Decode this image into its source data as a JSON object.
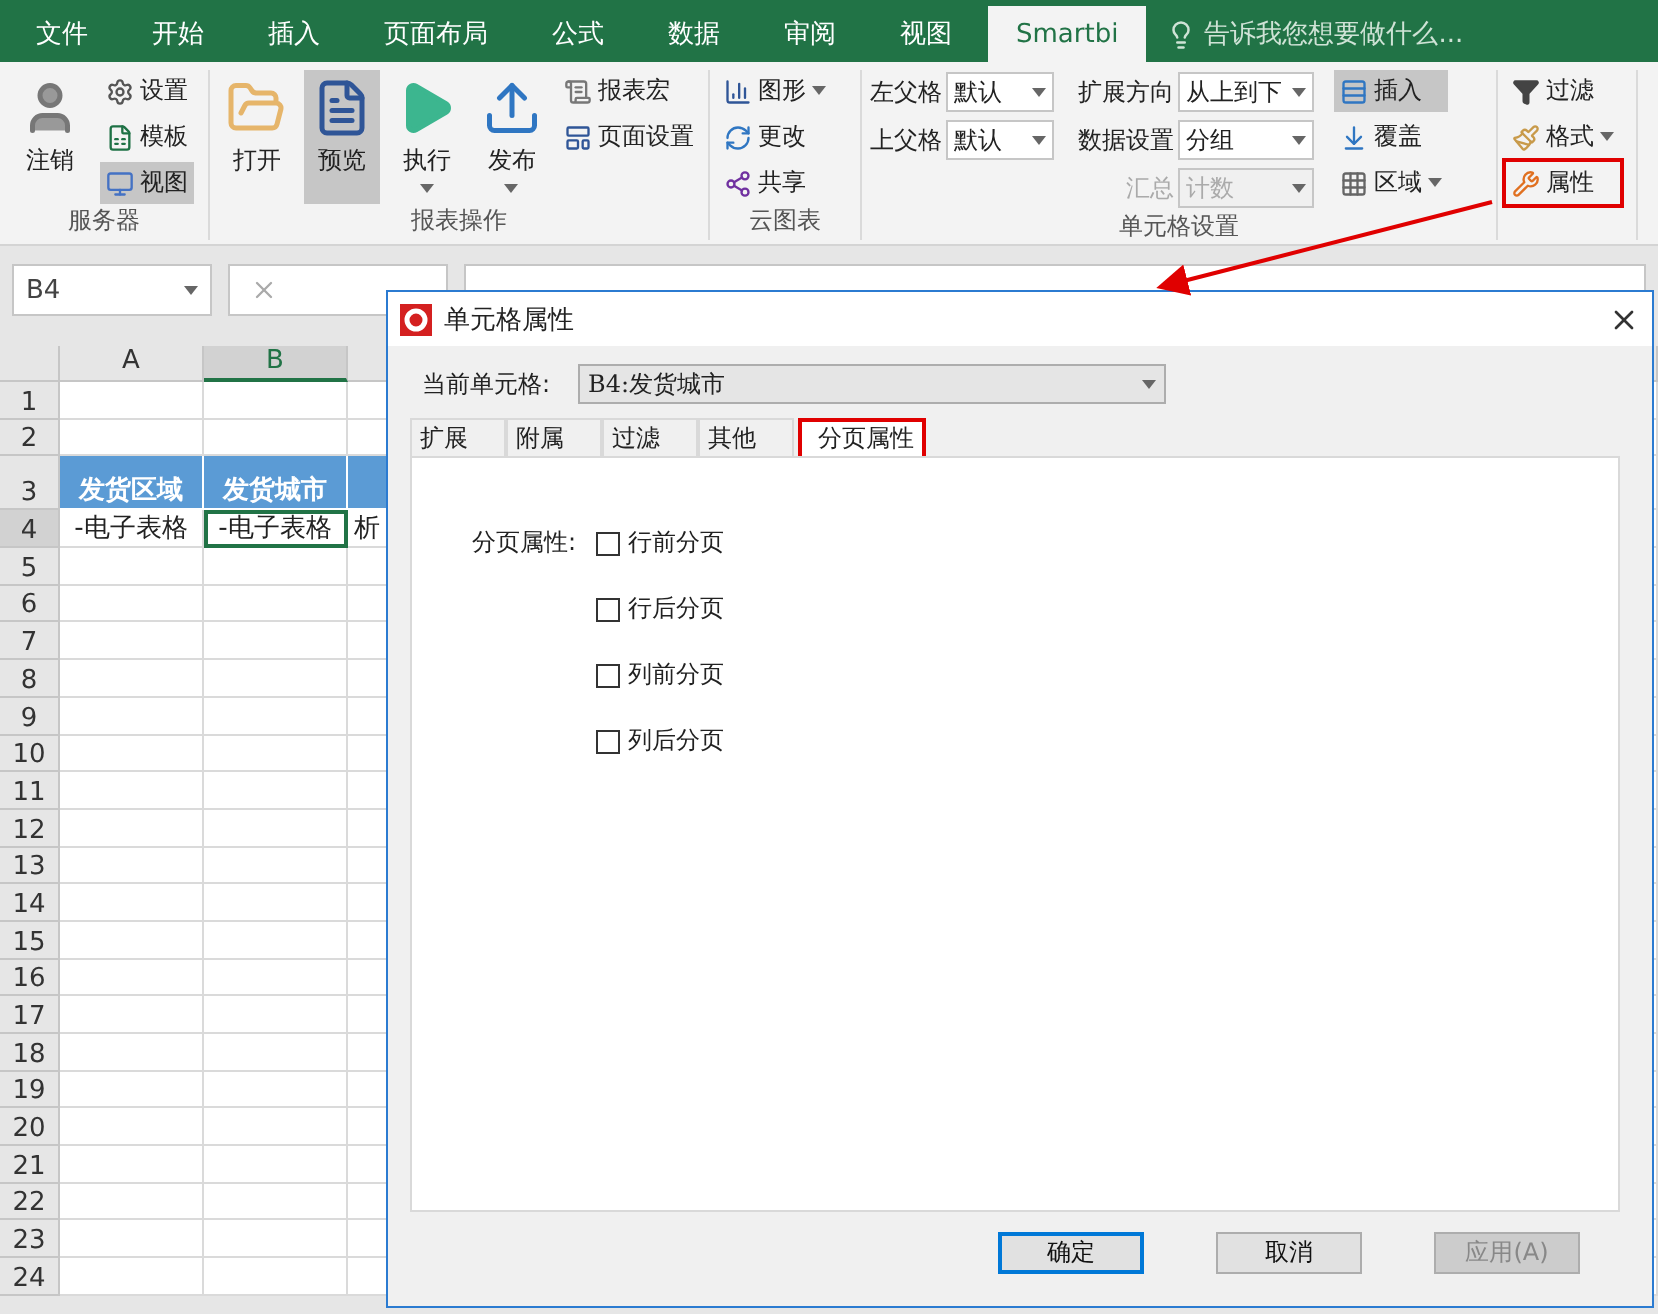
{
  "menu_tabs": [
    {
      "label": "文件",
      "selected": false
    },
    {
      "label": "开始",
      "selected": false
    },
    {
      "label": "插入",
      "selected": false
    },
    {
      "label": "页面布局",
      "selected": false
    },
    {
      "label": "公式",
      "selected": false
    },
    {
      "label": "数据",
      "selected": false
    },
    {
      "label": "审阅",
      "selected": false
    },
    {
      "label": "视图",
      "selected": false
    },
    {
      "label": "Smartbi",
      "selected": true
    }
  ],
  "tell_me": {
    "placeholder": "告诉我您想要做什么..."
  },
  "ribbon": {
    "server": {
      "title": "服务器",
      "large": {
        "label": "注销"
      },
      "small": [
        {
          "label": "设置",
          "selected": false
        },
        {
          "label": "模板",
          "selected": false
        },
        {
          "label": "视图",
          "selected": true
        }
      ]
    },
    "report": {
      "title": "报表操作",
      "large": [
        {
          "label": "打开",
          "selected": false,
          "dropdown": false
        },
        {
          "label": "预览",
          "selected": true,
          "dropdown": false
        },
        {
          "label": "执行",
          "selected": false,
          "dropdown": true
        },
        {
          "label": "发布",
          "selected": false,
          "dropdown": true
        }
      ],
      "small": [
        {
          "label": "报表宏"
        },
        {
          "label": "页面设置"
        }
      ]
    },
    "cloud": {
      "title": "云图表",
      "items": [
        {
          "label": "图形",
          "dropdown": true
        },
        {
          "label": "更改",
          "dropdown": false
        },
        {
          "label": "共享",
          "dropdown": false
        }
      ]
    },
    "cell": {
      "title": "单元格设置",
      "left_fields": [
        {
          "label": "左父格",
          "value": "默认",
          "disabled": false
        },
        {
          "label": "上父格",
          "value": "默认",
          "disabled": false
        }
      ],
      "right_fields": [
        {
          "label": "扩展方向",
          "value": "从上到下",
          "disabled": false
        },
        {
          "label": "数据设置",
          "value": "分组",
          "disabled": false
        },
        {
          "label": "汇总",
          "value": "计数",
          "disabled": true
        }
      ],
      "modes": [
        {
          "label": "插入",
          "selected": true,
          "dropdown": false
        },
        {
          "label": "覆盖",
          "selected": false,
          "dropdown": false
        },
        {
          "label": "区域",
          "selected": false,
          "dropdown": true
        }
      ]
    },
    "tools": [
      {
        "label": "过滤",
        "dropdown": false,
        "highlighted": false
      },
      {
        "label": "格式",
        "dropdown": true,
        "highlighted": false
      },
      {
        "label": "属性",
        "dropdown": false,
        "highlighted": true
      }
    ]
  },
  "name_box": {
    "value": "B4"
  },
  "sheet": {
    "columns": [
      {
        "label": "A",
        "selected": false
      },
      {
        "label": "B",
        "selected": true
      }
    ],
    "rows": [
      {
        "label": "1",
        "kind": "plain",
        "selected": false
      },
      {
        "label": "2",
        "kind": "plain",
        "selected": false
      },
      {
        "label": "3",
        "kind": "header",
        "selected": false,
        "cells": [
          {
            "text": "发货区域",
            "selected": false
          },
          {
            "text": "发货城市",
            "selected": false
          }
        ]
      },
      {
        "label": "4",
        "kind": "plain",
        "selected": true,
        "cells": [
          {
            "text": "-电子表格",
            "selected": false
          },
          {
            "text": "-电子表格",
            "selected": true
          },
          {
            "text": "析",
            "selected": false
          }
        ]
      },
      {
        "label": "5",
        "kind": "plain",
        "selected": false
      },
      {
        "label": "6",
        "kind": "plain",
        "selected": false
      },
      {
        "label": "7",
        "kind": "plain",
        "selected": false
      },
      {
        "label": "8",
        "kind": "plain",
        "selected": false
      },
      {
        "label": "9",
        "kind": "plain",
        "selected": false
      },
      {
        "label": "10",
        "kind": "plain",
        "selected": false
      },
      {
        "label": "11",
        "kind": "plain",
        "selected": false
      },
      {
        "label": "12",
        "kind": "plain",
        "selected": false
      },
      {
        "label": "13",
        "kind": "plain",
        "selected": false
      },
      {
        "label": "14",
        "kind": "plain",
        "selected": false
      },
      {
        "label": "15",
        "kind": "plain",
        "selected": false
      },
      {
        "label": "16",
        "kind": "plain",
        "selected": false
      },
      {
        "label": "17",
        "kind": "plain",
        "selected": false
      },
      {
        "label": "18",
        "kind": "plain",
        "selected": false
      },
      {
        "label": "19",
        "kind": "plain",
        "selected": false
      },
      {
        "label": "20",
        "kind": "plain",
        "selected": false
      },
      {
        "label": "21",
        "kind": "plain",
        "selected": false
      },
      {
        "label": "22",
        "kind": "plain",
        "selected": false
      },
      {
        "label": "23",
        "kind": "plain",
        "selected": false
      },
      {
        "label": "24",
        "kind": "plain",
        "selected": false
      }
    ]
  },
  "dialog": {
    "title": "单元格属性",
    "current_label": "当前单元格:",
    "current_value": "B4:发货城市",
    "tabs": [
      {
        "label": "扩展",
        "selected": false
      },
      {
        "label": "附属",
        "selected": false
      },
      {
        "label": "过滤",
        "selected": false
      },
      {
        "label": "其他",
        "selected": false
      },
      {
        "label": "分页属性",
        "selected": true
      }
    ],
    "section_label": "分页属性:",
    "checkboxes": [
      {
        "label": "行前分页",
        "checked": false
      },
      {
        "label": "行后分页",
        "checked": false
      },
      {
        "label": "列前分页",
        "checked": false
      },
      {
        "label": "列后分页",
        "checked": false
      }
    ],
    "buttons": [
      {
        "label": "确定",
        "kind": "default"
      },
      {
        "label": "取消",
        "kind": "normal"
      },
      {
        "label": "应用(A)",
        "kind": "disabled"
      }
    ]
  }
}
